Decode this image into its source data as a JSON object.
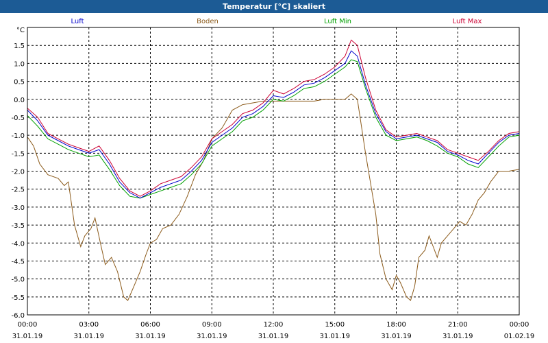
{
  "window": {
    "title": "Temperatur [°C] skaliert"
  },
  "colors": {
    "titlebar": "#1c5b95",
    "grid": "#000000",
    "background": "#ffffff"
  },
  "chart_data": {
    "type": "line",
    "title": "Temperatur [°C] skaliert",
    "ylabel": "°C",
    "xlabel": "",
    "ylim": [
      -6.0,
      2.0
    ],
    "yticks": [
      "1.5",
      "1.0",
      "0.5",
      "0.0",
      "-0.5",
      "-1.0",
      "-1.5",
      "-2.0",
      "-2.5",
      "-3.0",
      "-3.5",
      "-4.0",
      "-4.5",
      "-5.0",
      "-5.5",
      "-6.0"
    ],
    "xlim_hours": [
      0,
      24
    ],
    "xticks": [
      {
        "time": "00:00",
        "date": "31.01.19"
      },
      {
        "time": "03:00",
        "date": "31.01.19"
      },
      {
        "time": "06:00",
        "date": "31.01.19"
      },
      {
        "time": "09:00",
        "date": "31.01.19"
      },
      {
        "time": "12:00",
        "date": "31.01.19"
      },
      {
        "time": "15:00",
        "date": "31.01.19"
      },
      {
        "time": "18:00",
        "date": "31.01.19"
      },
      {
        "time": "21:00",
        "date": "31.01.19"
      },
      {
        "time": "00:00",
        "date": "01.02.19"
      }
    ],
    "grid": true,
    "legend_position": "top",
    "series": [
      {
        "name": "Luft",
        "color": "#0000cc",
        "points": [
          [
            0,
            -0.3
          ],
          [
            0.5,
            -0.6
          ],
          [
            1.0,
            -1.0
          ],
          [
            1.5,
            -1.15
          ],
          [
            2.0,
            -1.3
          ],
          [
            2.5,
            -1.4
          ],
          [
            3.0,
            -1.5
          ],
          [
            3.5,
            -1.4
          ],
          [
            4.0,
            -1.8
          ],
          [
            4.5,
            -2.3
          ],
          [
            5.0,
            -2.6
          ],
          [
            5.5,
            -2.75
          ],
          [
            6.0,
            -2.6
          ],
          [
            6.5,
            -2.45
          ],
          [
            7.0,
            -2.35
          ],
          [
            7.5,
            -2.25
          ],
          [
            8.0,
            -2.0
          ],
          [
            8.5,
            -1.7
          ],
          [
            9.0,
            -1.2
          ],
          [
            9.5,
            -1.0
          ],
          [
            10.0,
            -0.8
          ],
          [
            10.5,
            -0.5
          ],
          [
            11.0,
            -0.4
          ],
          [
            11.5,
            -0.2
          ],
          [
            12.0,
            0.1
          ],
          [
            12.5,
            0.05
          ],
          [
            13.0,
            0.2
          ],
          [
            13.5,
            0.4
          ],
          [
            14.0,
            0.45
          ],
          [
            14.5,
            0.6
          ],
          [
            15.0,
            0.8
          ],
          [
            15.5,
            1.0
          ],
          [
            15.8,
            1.35
          ],
          [
            16.1,
            1.2
          ],
          [
            16.5,
            0.4
          ],
          [
            17.0,
            -0.4
          ],
          [
            17.5,
            -0.9
          ],
          [
            18.0,
            -1.1
          ],
          [
            18.5,
            -1.05
          ],
          [
            19.0,
            -1.0
          ],
          [
            19.5,
            -1.1
          ],
          [
            20.0,
            -1.2
          ],
          [
            20.5,
            -1.45
          ],
          [
            21.0,
            -1.55
          ],
          [
            21.5,
            -1.7
          ],
          [
            22.0,
            -1.8
          ],
          [
            22.5,
            -1.5
          ],
          [
            23.0,
            -1.2
          ],
          [
            23.5,
            -1.0
          ],
          [
            24.0,
            -0.95
          ]
        ]
      },
      {
        "name": "Boden",
        "color": "#8b5a1a",
        "points": [
          [
            0,
            -1.05
          ],
          [
            0.3,
            -1.3
          ],
          [
            0.6,
            -1.8
          ],
          [
            1.0,
            -2.1
          ],
          [
            1.5,
            -2.2
          ],
          [
            1.8,
            -2.4
          ],
          [
            2.0,
            -2.3
          ],
          [
            2.3,
            -3.5
          ],
          [
            2.6,
            -4.1
          ],
          [
            2.8,
            -3.8
          ],
          [
            3.1,
            -3.6
          ],
          [
            3.3,
            -3.3
          ],
          [
            3.6,
            -4.1
          ],
          [
            3.8,
            -4.6
          ],
          [
            4.1,
            -4.4
          ],
          [
            4.4,
            -4.8
          ],
          [
            4.7,
            -5.5
          ],
          [
            4.9,
            -5.6
          ],
          [
            5.2,
            -5.2
          ],
          [
            5.5,
            -4.8
          ],
          [
            5.8,
            -4.3
          ],
          [
            6.0,
            -4.0
          ],
          [
            6.3,
            -3.9
          ],
          [
            6.6,
            -3.6
          ],
          [
            7.0,
            -3.5
          ],
          [
            7.4,
            -3.2
          ],
          [
            7.8,
            -2.7
          ],
          [
            8.2,
            -2.1
          ],
          [
            8.6,
            -1.7
          ],
          [
            9.0,
            -1.1
          ],
          [
            9.5,
            -0.8
          ],
          [
            10.0,
            -0.3
          ],
          [
            10.5,
            -0.15
          ],
          [
            11.0,
            -0.1
          ],
          [
            11.5,
            -0.05
          ],
          [
            12.0,
            -0.05
          ],
          [
            12.5,
            -0.05
          ],
          [
            13.0,
            -0.05
          ],
          [
            13.5,
            -0.05
          ],
          [
            14.0,
            -0.05
          ],
          [
            14.5,
            0.0
          ],
          [
            15.0,
            0.0
          ],
          [
            15.5,
            0.0
          ],
          [
            15.8,
            0.15
          ],
          [
            16.1,
            0.0
          ],
          [
            16.5,
            -1.5
          ],
          [
            17.0,
            -3.2
          ],
          [
            17.2,
            -4.3
          ],
          [
            17.5,
            -5.0
          ],
          [
            17.8,
            -5.3
          ],
          [
            18.0,
            -4.9
          ],
          [
            18.2,
            -5.1
          ],
          [
            18.5,
            -5.5
          ],
          [
            18.7,
            -5.6
          ],
          [
            18.9,
            -5.2
          ],
          [
            19.1,
            -4.4
          ],
          [
            19.4,
            -4.2
          ],
          [
            19.6,
            -3.8
          ],
          [
            19.8,
            -4.1
          ],
          [
            20.0,
            -4.4
          ],
          [
            20.2,
            -4.0
          ],
          [
            20.5,
            -3.8
          ],
          [
            20.8,
            -3.6
          ],
          [
            21.1,
            -3.4
          ],
          [
            21.4,
            -3.5
          ],
          [
            21.7,
            -3.2
          ],
          [
            22.0,
            -2.8
          ],
          [
            22.3,
            -2.6
          ],
          [
            22.6,
            -2.3
          ],
          [
            23.0,
            -2.0
          ],
          [
            23.5,
            -2.0
          ],
          [
            24.0,
            -1.95
          ]
        ]
      },
      {
        "name": "Luft Min",
        "color": "#00a000",
        "points": [
          [
            0,
            -0.45
          ],
          [
            0.5,
            -0.75
          ],
          [
            1.0,
            -1.1
          ],
          [
            1.5,
            -1.25
          ],
          [
            2.0,
            -1.4
          ],
          [
            2.5,
            -1.5
          ],
          [
            3.0,
            -1.6
          ],
          [
            3.5,
            -1.55
          ],
          [
            4.0,
            -1.95
          ],
          [
            4.5,
            -2.4
          ],
          [
            5.0,
            -2.7
          ],
          [
            5.5,
            -2.75
          ],
          [
            6.0,
            -2.65
          ],
          [
            6.5,
            -2.55
          ],
          [
            7.0,
            -2.45
          ],
          [
            7.5,
            -2.35
          ],
          [
            8.0,
            -2.1
          ],
          [
            8.5,
            -1.8
          ],
          [
            9.0,
            -1.3
          ],
          [
            9.5,
            -1.1
          ],
          [
            10.0,
            -0.9
          ],
          [
            10.5,
            -0.6
          ],
          [
            11.0,
            -0.5
          ],
          [
            11.5,
            -0.3
          ],
          [
            12.0,
            0.0
          ],
          [
            12.5,
            -0.05
          ],
          [
            13.0,
            0.1
          ],
          [
            13.5,
            0.3
          ],
          [
            14.0,
            0.35
          ],
          [
            14.5,
            0.5
          ],
          [
            15.0,
            0.7
          ],
          [
            15.5,
            0.9
          ],
          [
            15.8,
            1.1
          ],
          [
            16.1,
            1.05
          ],
          [
            16.5,
            0.3
          ],
          [
            17.0,
            -0.5
          ],
          [
            17.5,
            -1.0
          ],
          [
            18.0,
            -1.15
          ],
          [
            18.5,
            -1.1
          ],
          [
            19.0,
            -1.05
          ],
          [
            19.5,
            -1.15
          ],
          [
            20.0,
            -1.3
          ],
          [
            20.5,
            -1.5
          ],
          [
            21.0,
            -1.6
          ],
          [
            21.5,
            -1.8
          ],
          [
            22.0,
            -1.9
          ],
          [
            22.5,
            -1.6
          ],
          [
            23.0,
            -1.3
          ],
          [
            23.5,
            -1.05
          ],
          [
            24.0,
            -1.0
          ]
        ]
      },
      {
        "name": "Luft Max",
        "color": "#cc0033",
        "points": [
          [
            0,
            -0.25
          ],
          [
            0.5,
            -0.5
          ],
          [
            1.0,
            -0.95
          ],
          [
            1.5,
            -1.1
          ],
          [
            2.0,
            -1.25
          ],
          [
            2.5,
            -1.35
          ],
          [
            3.0,
            -1.45
          ],
          [
            3.5,
            -1.3
          ],
          [
            4.0,
            -1.7
          ],
          [
            4.5,
            -2.2
          ],
          [
            5.0,
            -2.55
          ],
          [
            5.5,
            -2.7
          ],
          [
            6.0,
            -2.55
          ],
          [
            6.5,
            -2.35
          ],
          [
            7.0,
            -2.25
          ],
          [
            7.5,
            -2.15
          ],
          [
            8.0,
            -1.9
          ],
          [
            8.5,
            -1.6
          ],
          [
            9.0,
            -1.1
          ],
          [
            9.5,
            -0.9
          ],
          [
            10.0,
            -0.7
          ],
          [
            10.5,
            -0.4
          ],
          [
            11.0,
            -0.3
          ],
          [
            11.5,
            -0.1
          ],
          [
            12.0,
            0.25
          ],
          [
            12.5,
            0.15
          ],
          [
            13.0,
            0.3
          ],
          [
            13.5,
            0.5
          ],
          [
            14.0,
            0.55
          ],
          [
            14.5,
            0.7
          ],
          [
            15.0,
            0.9
          ],
          [
            15.5,
            1.2
          ],
          [
            15.8,
            1.65
          ],
          [
            16.1,
            1.5
          ],
          [
            16.5,
            0.6
          ],
          [
            17.0,
            -0.3
          ],
          [
            17.5,
            -0.85
          ],
          [
            18.0,
            -1.05
          ],
          [
            18.5,
            -1.0
          ],
          [
            19.0,
            -0.95
          ],
          [
            19.5,
            -1.05
          ],
          [
            20.0,
            -1.15
          ],
          [
            20.5,
            -1.4
          ],
          [
            21.0,
            -1.5
          ],
          [
            21.5,
            -1.6
          ],
          [
            22.0,
            -1.7
          ],
          [
            22.5,
            -1.45
          ],
          [
            23.0,
            -1.15
          ],
          [
            23.5,
            -0.95
          ],
          [
            24.0,
            -0.9
          ]
        ]
      }
    ]
  }
}
